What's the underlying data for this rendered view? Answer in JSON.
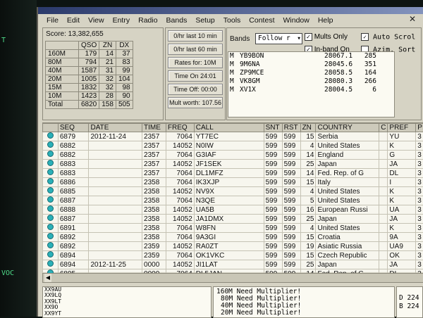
{
  "menu": [
    "File",
    "Edit",
    "View",
    "Entry",
    "Radio",
    "Bands",
    "Setup",
    "Tools",
    "Contest",
    "Window",
    "Help"
  ],
  "score": {
    "title": "Score: 13,382,655",
    "headers": [
      "",
      "QSO",
      "ZN",
      "DX"
    ],
    "rows": [
      [
        "160M",
        "179",
        "14",
        "37"
      ],
      [
        "80M",
        "794",
        "21",
        "83"
      ],
      [
        "40M",
        "1587",
        "31",
        "99"
      ],
      [
        "20M",
        "1005",
        "32",
        "104"
      ],
      [
        "15M",
        "1832",
        "32",
        "98"
      ],
      [
        "10M",
        "1423",
        "28",
        "90"
      ],
      [
        "Total",
        "6820",
        "158",
        "505"
      ]
    ]
  },
  "rates": {
    "last10": "0/hr last 10 min",
    "last60": "0/hr last 60 min",
    "rates_for": "Rates for: 10M",
    "time_on": "Time On 24:01",
    "time_off": "Time Off: 00:00",
    "mult_worth": "Mult worth: 107.56"
  },
  "bands": {
    "label": "Bands",
    "select": "Follow r",
    "mults_only": "Mults Only",
    "auto_scroll": "Auto Scrol",
    "inband_only": "In-band On",
    "azim_sort": "Azim. Sort"
  },
  "spots": [
    {
      "m": "M",
      "call": "YB9BON",
      "freq": "28067.1",
      "az": "285"
    },
    {
      "m": "M",
      "call": "9M6NA",
      "freq": "28045.6",
      "az": "351"
    },
    {
      "m": "M",
      "call": "ZP9MCE",
      "freq": "28058.5",
      "az": "164"
    },
    {
      "m": "M",
      "call": "VK8GM",
      "freq": "28080.3",
      "az": "266"
    },
    {
      "m": "M",
      "call": "XV1X",
      "freq": "28004.5",
      "az": "6"
    }
  ],
  "log": {
    "headers": [
      "SEQ",
      "DATE",
      "TIME",
      "FREQ",
      "CALL",
      "SNT",
      "RST",
      "ZN",
      "COUNTRY",
      "C",
      "PREF",
      "P"
    ],
    "rows": [
      [
        "6879",
        "2012-11-24",
        "2357",
        "7064",
        "YT7EC",
        "599",
        "599",
        "15",
        "Serbia",
        "",
        "YU",
        "3"
      ],
      [
        "6882",
        "",
        "2357",
        "14052",
        "N0IW",
        "599",
        "599",
        "4",
        "United States",
        "",
        "K",
        "3"
      ],
      [
        "6882",
        "",
        "2357",
        "7064",
        "G3IAF",
        "599",
        "599",
        "14",
        "England",
        "",
        "G",
        "3"
      ],
      [
        "6883",
        "",
        "2357",
        "14052",
        "JF1SEK",
        "599",
        "599",
        "25",
        "Japan",
        "",
        "JA",
        "3"
      ],
      [
        "6883",
        "",
        "2357",
        "7064",
        "DL1MFZ",
        "599",
        "599",
        "14",
        "Fed. Rep. of G",
        "",
        "DL",
        "3"
      ],
      [
        "6886",
        "",
        "2358",
        "7064",
        "IK3XJP",
        "599",
        "599",
        "15",
        "Italy",
        "",
        "I",
        "3"
      ],
      [
        "6885",
        "",
        "2358",
        "14052",
        "NV9X",
        "599",
        "599",
        "4",
        "United States",
        "",
        "K",
        "3"
      ],
      [
        "6887",
        "",
        "2358",
        "7064",
        "N3QE",
        "599",
        "599",
        "5",
        "United States",
        "",
        "K",
        "3"
      ],
      [
        "6888",
        "",
        "2358",
        "14052",
        "UA5B",
        "599",
        "599",
        "16",
        "European Russi",
        "",
        "UA",
        "3"
      ],
      [
        "6887",
        "",
        "2358",
        "14052",
        "JA1DMX",
        "599",
        "599",
        "25",
        "Japan",
        "",
        "JA",
        "3"
      ],
      [
        "6891",
        "",
        "2358",
        "7064",
        "W8FN",
        "599",
        "599",
        "4",
        "United States",
        "",
        "K",
        "3"
      ],
      [
        "6892",
        "",
        "2358",
        "7064",
        "9A3GI",
        "599",
        "599",
        "15",
        "Croatia",
        "",
        "9A",
        "3"
      ],
      [
        "6892",
        "",
        "2359",
        "14052",
        "RA0ZT",
        "599",
        "599",
        "19",
        "Asiatic Russia",
        "",
        "UA9",
        "3"
      ],
      [
        "6894",
        "",
        "2359",
        "7064",
        "OK1VKC",
        "599",
        "599",
        "15",
        "Czech Republic",
        "",
        "OK",
        "3"
      ],
      [
        "6894",
        "2012-11-25",
        "0000",
        "14052",
        "JI1LAT",
        "599",
        "599",
        "25",
        "Japan",
        "",
        "JA",
        "3"
      ],
      [
        "6895",
        "",
        "0000",
        "7064",
        "DL5JAN",
        "599",
        "599",
        "14",
        "Fed. Rep. of G",
        "",
        "DL",
        "3"
      ]
    ]
  },
  "bottom_left": [
    "XX9AU",
    "XX9LQ",
    "XX9LT",
    "XX9O",
    "XX9YT"
  ],
  "mult_needs": [
    "160M Need Multiplier!",
    "80M Need Multiplier!",
    "40M Need Multiplier!",
    "20M Need Multiplier!"
  ],
  "bottom_right": [
    "D 224",
    "B 224"
  ],
  "left_edge": [
    "T",
    "VOC"
  ],
  "colors": {
    "window": "#d6d3c4",
    "list_bg": "#fbfaf2",
    "spot_dot": "#2ab0b8"
  }
}
